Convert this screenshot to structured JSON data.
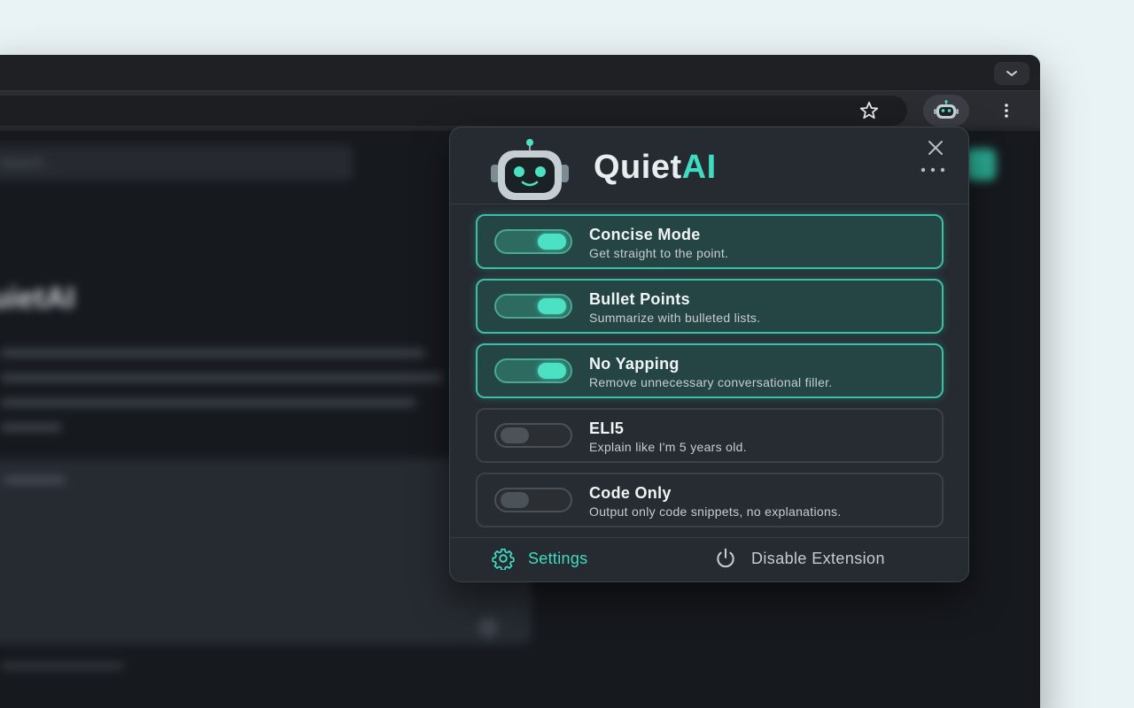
{
  "browser": {
    "toolbar": {
      "bookmark_icon": "star-icon",
      "extension_icon": "robot-icon",
      "menu_icon": "kebab-menu-icon"
    },
    "tabstrip": {
      "dropdown_icon": "chevron-down-icon"
    }
  },
  "background_page": {
    "search_placeholder": "Search...",
    "title": "uietAI"
  },
  "popup": {
    "brand": {
      "name_part1": "Quiet",
      "name_part2": "AI"
    },
    "close_icon": "close-icon",
    "more_icon": "more-horizontal-icon",
    "options": [
      {
        "title": "Concise Mode",
        "description": "Get straight to the point.",
        "enabled": true
      },
      {
        "title": "Bullet Points",
        "description": "Summarize with bulleted lists.",
        "enabled": true
      },
      {
        "title": "No Yapping",
        "description": "Remove unnecessary conversational filler.",
        "enabled": true
      },
      {
        "title": "ELI5",
        "description": "Explain like I'm 5 years old.",
        "enabled": false
      },
      {
        "title": "Code Only",
        "description": "Output only code snippets, no explanations.",
        "enabled": false
      }
    ],
    "footer": {
      "settings_label": "Settings",
      "disable_label": "Disable Extension"
    }
  },
  "colors": {
    "accent": "#3fdcc4",
    "popup_bg": "#252b30",
    "page_bg": "#e9f2f4"
  }
}
